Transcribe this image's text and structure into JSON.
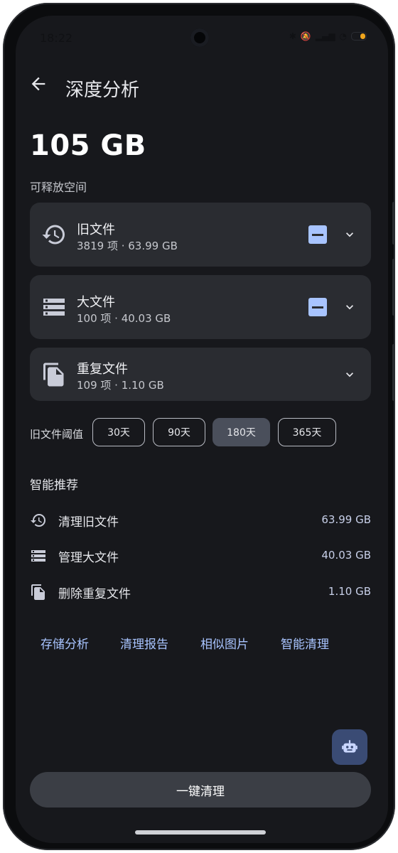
{
  "status": {
    "time": "18:22"
  },
  "header": {
    "title": "深度分析"
  },
  "summary": {
    "size": "105 GB",
    "label": "可释放空间"
  },
  "cards": [
    {
      "name": "旧文件",
      "meta": "3819 项 · 63.99 GB",
      "icon": "history-icon",
      "selection": "partial"
    },
    {
      "name": "大文件",
      "meta": "100 项 · 40.03 GB",
      "icon": "storage-list-icon",
      "selection": "partial"
    },
    {
      "name": "重复文件",
      "meta": "109 项 · 1.10 GB",
      "icon": "duplicate-file-icon",
      "selection": "none"
    }
  ],
  "threshold": {
    "label": "旧文件阈值",
    "options": [
      "30天",
      "90天",
      "180天",
      "365天"
    ],
    "selected": "180天"
  },
  "recommendations": {
    "title": "智能推荐",
    "items": [
      {
        "label": "清理旧文件",
        "value": "63.99 GB",
        "icon": "history-icon"
      },
      {
        "label": "管理大文件",
        "value": "40.03 GB",
        "icon": "storage-list-icon"
      },
      {
        "label": "删除重复文件",
        "value": "1.10 GB",
        "icon": "duplicate-file-icon"
      }
    ]
  },
  "links": [
    "存储分析",
    "清理报告",
    "相似图片",
    "智能清理"
  ],
  "fab": {
    "icon": "robot-icon"
  },
  "primary_button": {
    "label": "一键清理"
  },
  "colors": {
    "accent": "#a8c4ff",
    "background": "#17181c",
    "card": "#2a2c31"
  }
}
